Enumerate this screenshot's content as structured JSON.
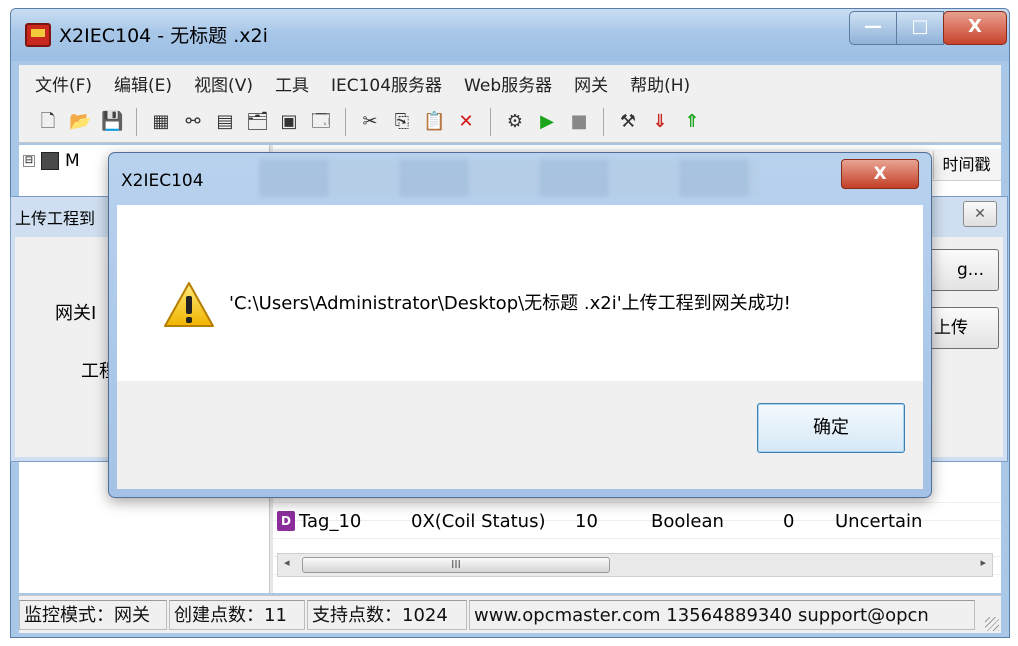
{
  "main_window": {
    "title": "X2IEC104 - 无标题 .x2i",
    "controls": {
      "minimize": "—",
      "maximize": "□",
      "close": "X"
    }
  },
  "menu": {
    "items": [
      "文件(F)",
      "编辑(E)",
      "视图(V)",
      "工具",
      "IEC104服务器",
      "Web服务器",
      "网关",
      "帮助(H)"
    ]
  },
  "toolbar": {
    "icons": [
      {
        "name": "new-icon",
        "glyph": "🗋"
      },
      {
        "name": "open-icon",
        "glyph": "📂"
      },
      {
        "name": "save-icon",
        "glyph": "💾"
      },
      {
        "name": "device-icon",
        "glyph": "▦"
      },
      {
        "name": "link-icon",
        "glyph": "⚯"
      },
      {
        "name": "page-icon",
        "glyph": "▤"
      },
      {
        "name": "new-folder-icon",
        "glyph": "🗂"
      },
      {
        "name": "add-tag-icon",
        "glyph": "▣"
      },
      {
        "name": "properties-icon",
        "glyph": "🗔"
      },
      {
        "name": "cut-icon",
        "glyph": "✂"
      },
      {
        "name": "copy-icon",
        "glyph": "⎘"
      },
      {
        "name": "paste-icon",
        "glyph": "📋"
      },
      {
        "name": "delete-icon",
        "glyph": "✕"
      },
      {
        "name": "tools-icon",
        "glyph": "⚙"
      },
      {
        "name": "run-icon",
        "glyph": "▶"
      },
      {
        "name": "stop-icon",
        "glyph": "■"
      },
      {
        "name": "build-icon",
        "glyph": "⚒"
      },
      {
        "name": "download-icon",
        "glyph": "⇓"
      },
      {
        "name": "upload-icon",
        "glyph": "⇑"
      }
    ],
    "colors": {
      "run": "#1aa51a",
      "delete": "#d01818",
      "stop": "#888888"
    }
  },
  "tree": {
    "root_label": "M",
    "expander": "⊟"
  },
  "grid": {
    "column_timestamp": "时间戳",
    "row": {
      "tag_icon": "D",
      "name": "Tag_10",
      "address": "0X(Coil Status)",
      "offset": "10",
      "type": "Boolean",
      "value": "0",
      "quality": "Uncertain"
    },
    "scroll_left": "◂",
    "scroll_right": "▸",
    "scroll_grip": "III"
  },
  "upload_dialog": {
    "title": "上传工程到",
    "close": "✕",
    "label_gateway": "网关I",
    "label_project": "工程",
    "browse_button": "g...",
    "upload_button": "上传"
  },
  "message_box": {
    "title": "X2IEC104",
    "close": "X",
    "message": "'C:\\Users\\Administrator\\Desktop\\无标题 .x2i'上传工程到网关成功!",
    "ok_button": "确定",
    "icon": "warning-icon"
  },
  "status_bar": {
    "mode": "监控模式：网关",
    "created_points": "创建点数：11",
    "supported_points": "支持点数：1024",
    "contact": "www.opcmaster.com 13564889340 support@opcn"
  }
}
